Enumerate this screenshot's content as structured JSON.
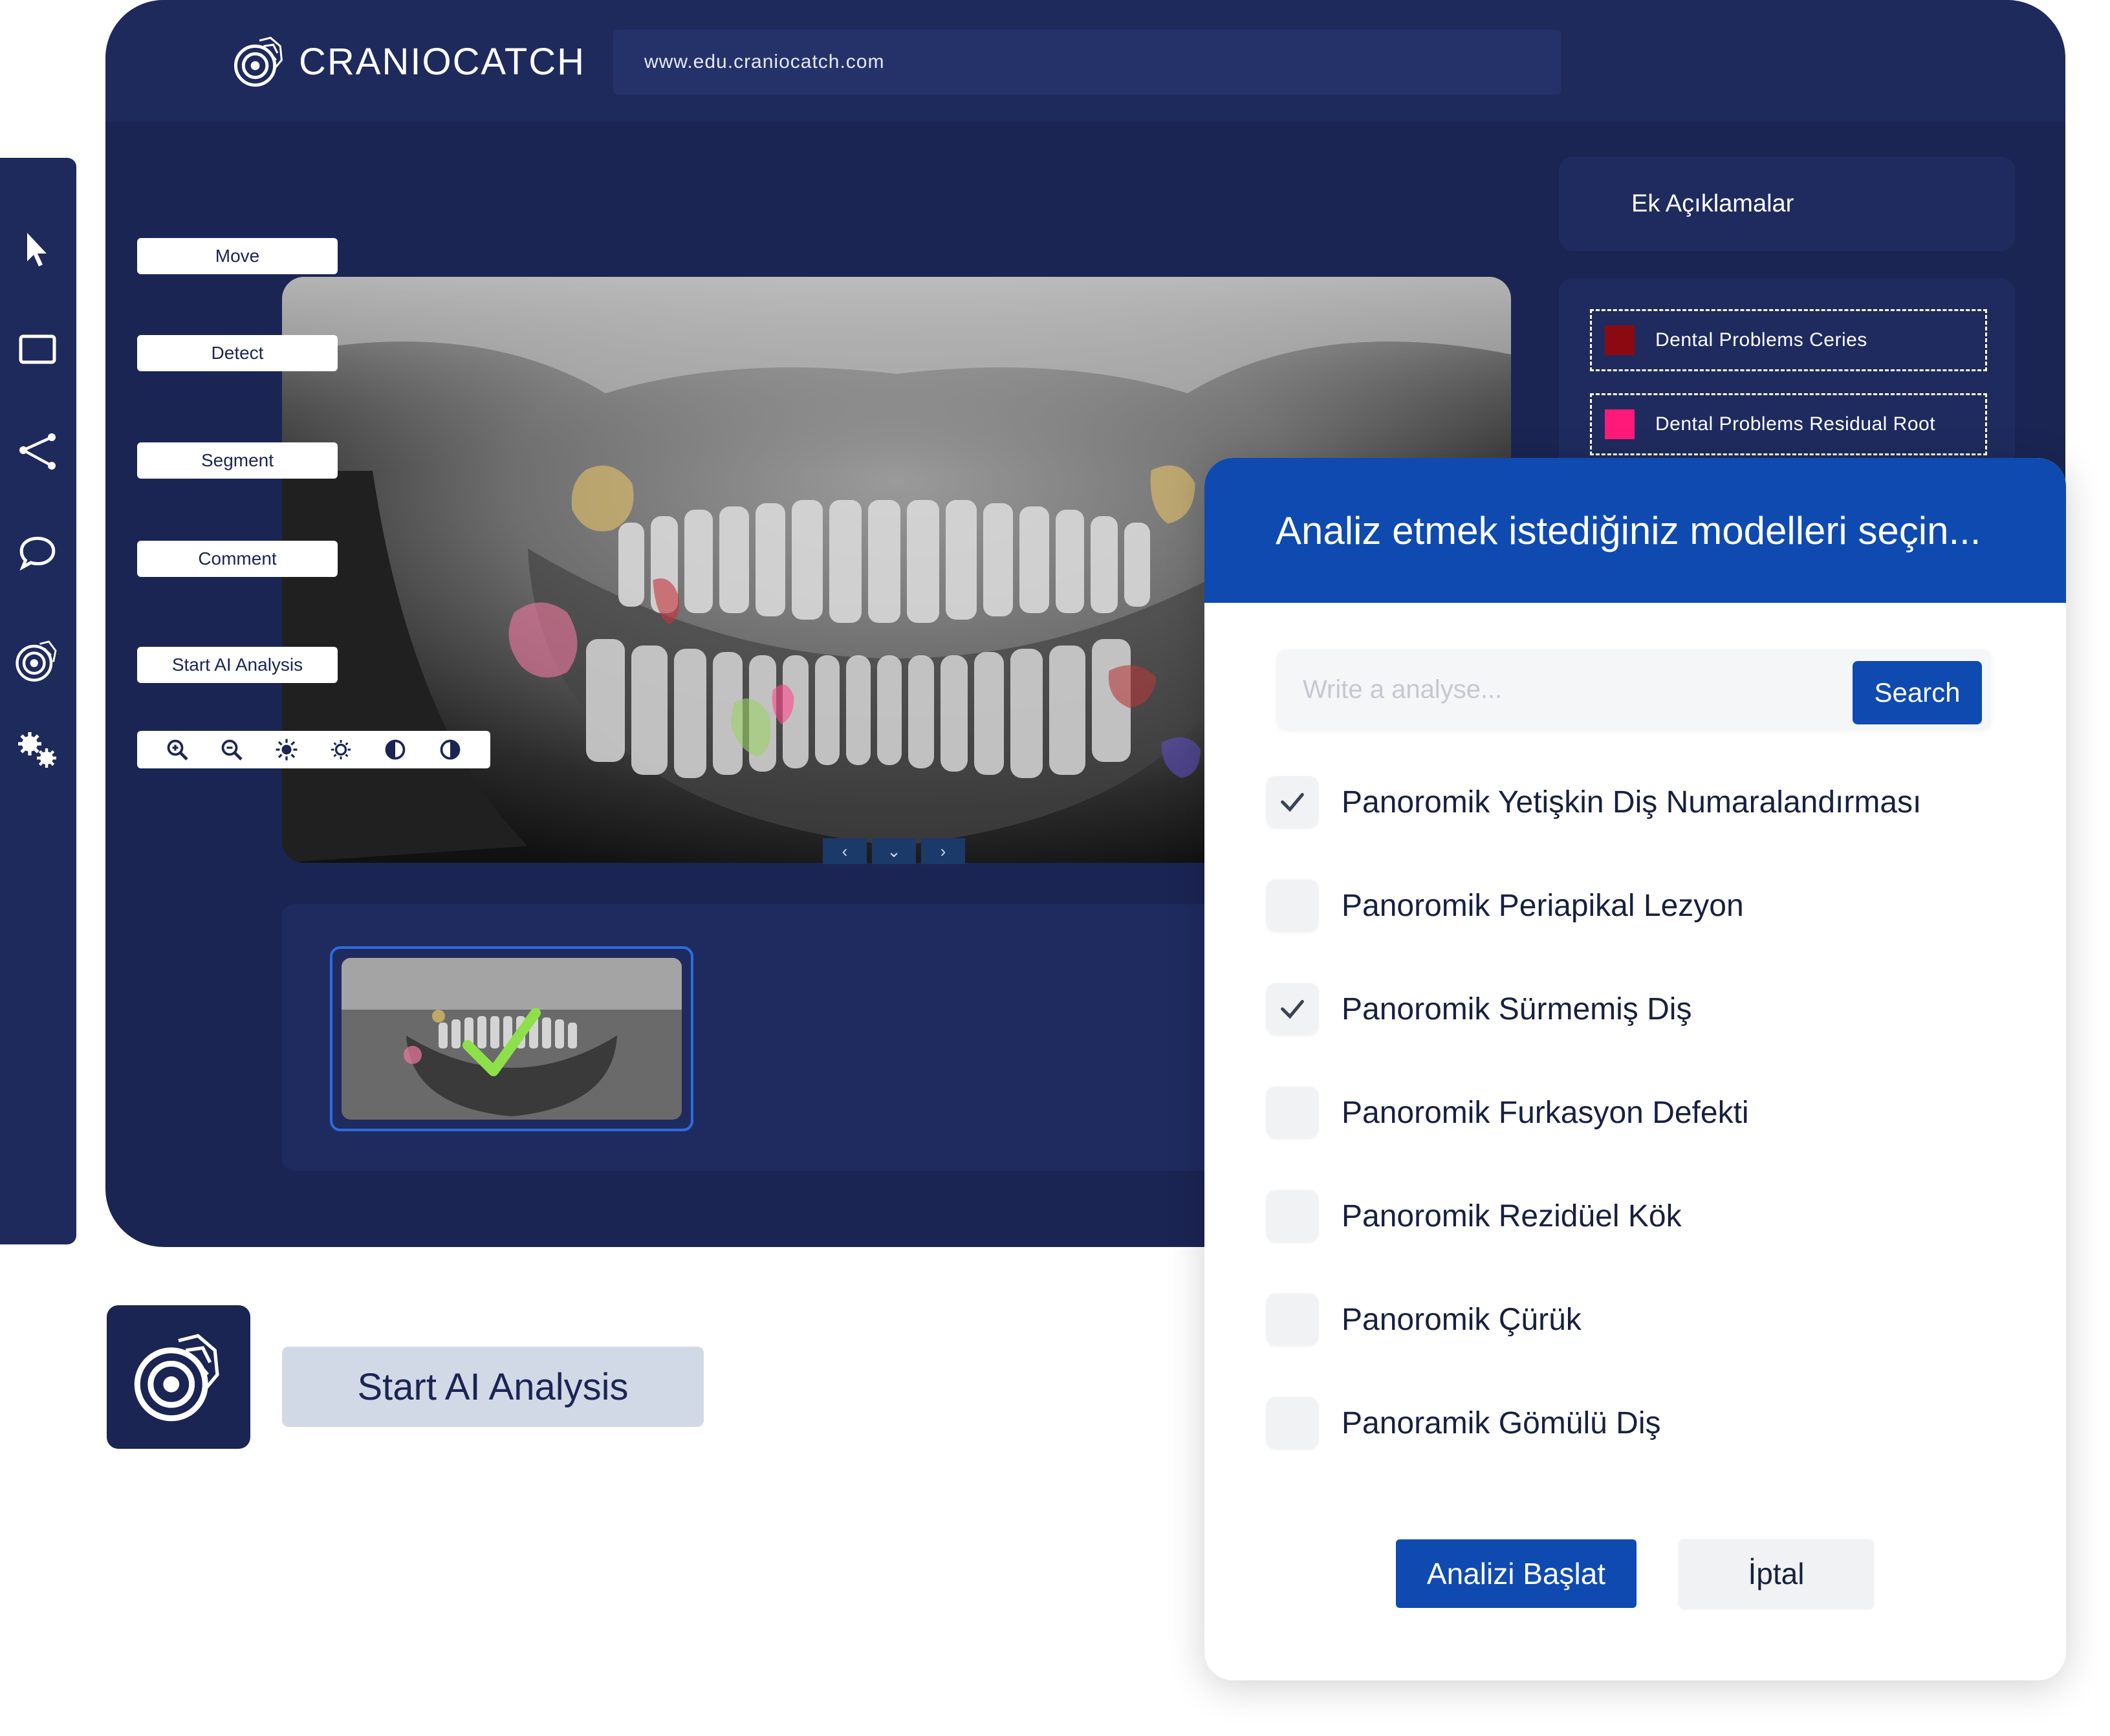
{
  "brand": {
    "name": "CRANIOCATCH"
  },
  "browser": {
    "url": "www.edu.craniocatch.com"
  },
  "sidebar": {
    "items": [
      {
        "name": "cursor-icon"
      },
      {
        "name": "rectangle-icon"
      },
      {
        "name": "polyline-icon"
      },
      {
        "name": "comment-icon"
      },
      {
        "name": "ai-icon"
      },
      {
        "name": "settings-icon"
      }
    ]
  },
  "tools": {
    "move": "Move",
    "detect": "Detect",
    "segment": "Segment",
    "comment": "Comment",
    "start_ai": "Start AI Analysis"
  },
  "viewer_controls": [
    "zoom-in-icon",
    "zoom-out-icon",
    "brightness-up-icon",
    "brightness-down-icon",
    "contrast-up-icon",
    "contrast-down-icon"
  ],
  "xray_nav": {
    "prev": "‹",
    "down": "⌄",
    "next": "›"
  },
  "annotations": {
    "title": "Ek Açıklamalar",
    "legend": [
      {
        "label": "Dental Problems Ceries",
        "color": "#8b0a12"
      },
      {
        "label": "Dental Problems Residual Root",
        "color": "#ff1a7a"
      }
    ]
  },
  "modal": {
    "title": "Analiz etmek istediğiniz modelleri seçin...",
    "search_placeholder": "Write a analyse...",
    "search_button": "Search",
    "models": [
      {
        "label": "Panoromik Yetişkin Diş Numaralandırması",
        "checked": true
      },
      {
        "label": "Panoromik Periapikal Lezyon",
        "checked": false
      },
      {
        "label": "Panoromik Sürmemiş Diş",
        "checked": true
      },
      {
        "label": "Panoromik Furkasyon Defekti",
        "checked": false
      },
      {
        "label": "Panoromik Rezidüel Kök",
        "checked": false
      },
      {
        "label": "Panoromik Çürük",
        "checked": false
      },
      {
        "label": "Panoramik Gömülü Diş",
        "checked": false
      }
    ],
    "start_button": "Analizi Başlat",
    "cancel_button": "İptal"
  },
  "footer": {
    "start_ai_label": "Start AI Analysis"
  },
  "colors": {
    "navy": "#1b2553",
    "accent_blue": "#0f4ab0"
  }
}
